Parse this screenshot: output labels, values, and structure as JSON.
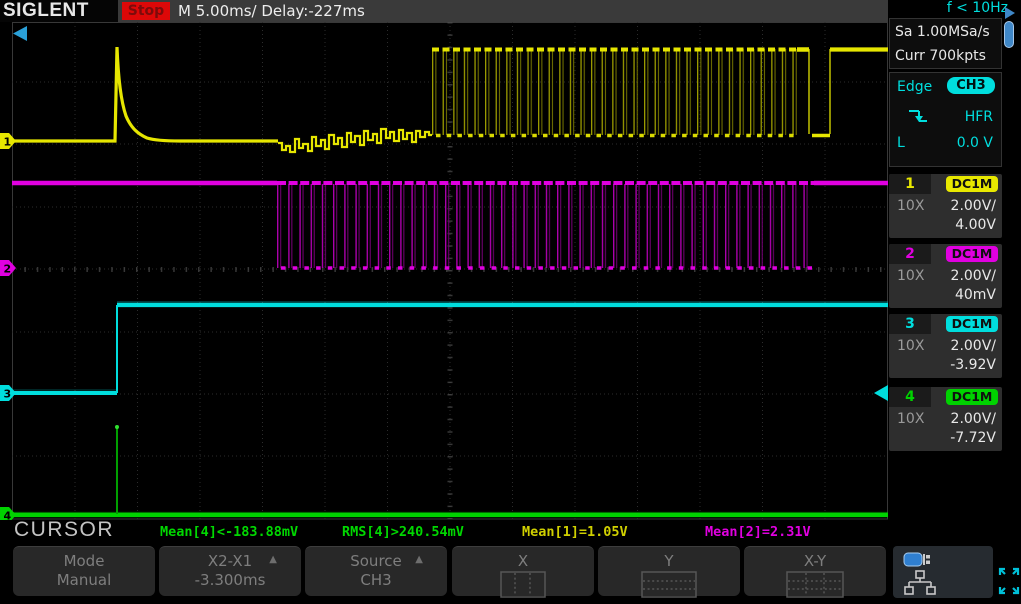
{
  "header": {
    "brand": "SIGLENT",
    "acq_status": "Stop",
    "timebase": "M 5.00ms/",
    "delay": "Delay:-227ms",
    "trigger_frequency": "f < 10Hz"
  },
  "acquisition": {
    "sample_rate": "Sa 1.00MSa/s",
    "memory_depth": "Curr 700kpts"
  },
  "trigger": {
    "type": "Edge",
    "source": "CH3",
    "coupling": "HFR",
    "level_label": "L",
    "level": "0.0 V"
  },
  "channels": [
    {
      "id": "1",
      "coupling": "DC1M",
      "probe": "10X",
      "scale": "2.00V/",
      "offset": "4.00V",
      "color": "#e8e800"
    },
    {
      "id": "2",
      "coupling": "DC1M",
      "probe": "10X",
      "scale": "2.00V/",
      "offset": "40mV",
      "color": "#e000e0"
    },
    {
      "id": "3",
      "coupling": "DC1M",
      "probe": "10X",
      "scale": "2.00V/",
      "offset": "-3.92V",
      "color": "#00dede"
    },
    {
      "id": "4",
      "coupling": "DC1M",
      "probe": "10X",
      "scale": "2.00V/",
      "offset": "-7.72V",
      "color": "#00d200"
    }
  ],
  "measurements": {
    "title": "CURSOR",
    "items": [
      {
        "label": "Mean[4]<-183.88mV",
        "color": "#00d800"
      },
      {
        "label": "RMS[4]>240.54mV",
        "color": "#00d800"
      },
      {
        "label": "Mean[1]=1.05V",
        "color": "#d0d000"
      },
      {
        "label": "Mean[2]=2.31V",
        "color": "#e000e0"
      }
    ]
  },
  "menu": {
    "buttons": [
      {
        "line1": "Mode",
        "line2": "Manual"
      },
      {
        "line1": "X2-X1",
        "line2": "-3.300ms",
        "arrow": "▲"
      },
      {
        "line1": "Source",
        "line2": "CH3",
        "arrow": "▲"
      },
      {
        "line1": "X"
      },
      {
        "line1": "Y"
      },
      {
        "line1": "X-Y"
      }
    ]
  }
}
